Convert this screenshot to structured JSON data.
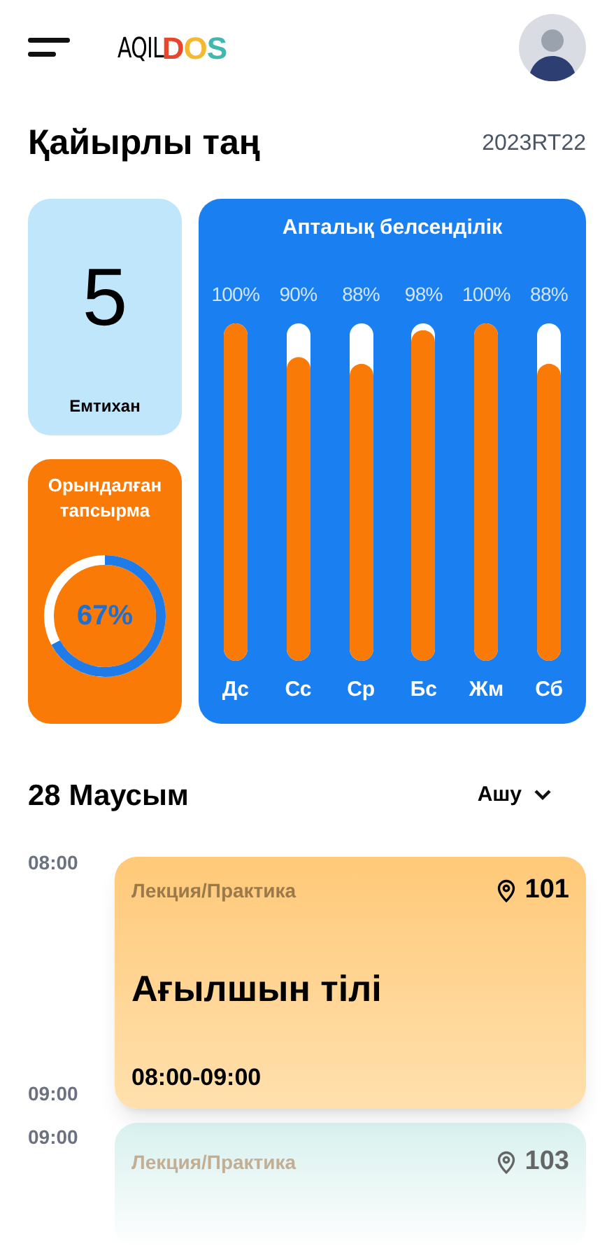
{
  "header": {
    "logo": {
      "prefix": "AQIL",
      "letters": [
        {
          "char": "D",
          "color": "#e8452c"
        },
        {
          "char": "O",
          "color": "#f5b82e"
        },
        {
          "char": "S",
          "color": "#3fb8b0"
        }
      ]
    }
  },
  "greeting": {
    "title": "Қайырлы таң",
    "code": "2023RT22"
  },
  "exam_card": {
    "count": "5",
    "label": "Емтихан"
  },
  "tasks_card": {
    "title": "Орындалған тапсырма",
    "reading": "67%"
  },
  "activity": {
    "chart_data": {
      "type": "bar",
      "title": "Апталық белсенділік",
      "categories": [
        "Дс",
        "Сс",
        "Ср",
        "Бс",
        "Жм",
        "Сб"
      ],
      "values": [
        100,
        90,
        88,
        98,
        100,
        88
      ],
      "ylim": [
        0,
        100
      ],
      "value_labels": [
        "100%",
        "90%",
        "88%",
        "98%",
        "100%",
        "88%"
      ]
    }
  },
  "schedule": {
    "date": "28 Маусым",
    "toggle": "Ашу",
    "lessons": [
      {
        "start_label": "08:00",
        "end_label": "09:00",
        "type": "Лекция/Практика",
        "room": "101",
        "subject": "Ағылшын тілі",
        "time": "08:00-09:00",
        "faded": false
      },
      {
        "start_label": "09:00",
        "type": "Лекция/Практика",
        "room": "103",
        "faded": true
      }
    ]
  }
}
